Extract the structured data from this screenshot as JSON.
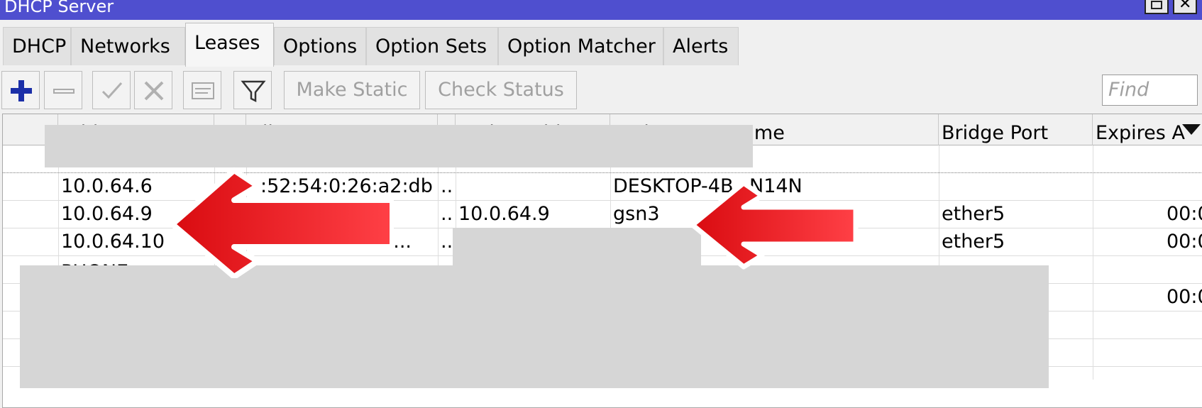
{
  "window": {
    "title": "DHCP Server",
    "maximize_icon": "maximize-icon",
    "close_icon": "close-icon",
    "close_glyph": "✕"
  },
  "tabs": [
    {
      "label": "DHCP"
    },
    {
      "label": "Networks"
    },
    {
      "label": "Leases"
    },
    {
      "label": "Options"
    },
    {
      "label": "Option Sets"
    },
    {
      "label": "Option Matcher"
    },
    {
      "label": "Alerts"
    }
  ],
  "active_tab": "Leases",
  "toolbar": {
    "icons": [
      "add-icon",
      "remove-icon",
      "enable-icon",
      "disable-icon",
      "comment-icon",
      "filter-icon"
    ],
    "make_static_label": "Make Static",
    "check_status_label": "Check Status",
    "find_placeholder": "Find",
    "accent_color": "#1b2fa8"
  },
  "table": {
    "columns": [
      "Address",
      "",
      "Client ID",
      "",
      "Active Address",
      "Active Host Name",
      "Bridge Port",
      "Expires A"
    ],
    "rows": [
      {
        "address": "",
        "client_id": "",
        "dots": "",
        "active_address": "",
        "host_name": "",
        "bridge_port": "",
        "expires": ""
      },
      {
        "address": "10.0.64.6",
        "client_id": ":52:54:0:26:a2:db",
        "dots": "..",
        "active_address": "",
        "host_name": "DESKTOP-4B",
        "host_name_tail": "N14N",
        "bridge_port": "",
        "expires": ""
      },
      {
        "address": "10.0.64.9",
        "client_id": "",
        "dots": "..",
        "active_address": "10.0.64.9",
        "host_name": "gsn3",
        "bridge_port": "ether5",
        "expires": "00:0"
      },
      {
        "address": "10.0.64.10",
        "client_id": "d:...",
        "dots": "..",
        "active_address": "",
        "host_name": "",
        "bridge_port": "ether5",
        "expires": "00:0"
      },
      {
        "address": "PHONE",
        "client_id": "",
        "dots": "",
        "active_address": "",
        "host_name": "",
        "bridge_port": "",
        "expires": ""
      },
      {
        "address": "",
        "client_id": "",
        "dots": "",
        "active_address": "",
        "host_name": "",
        "bridge_port": "",
        "expires": "00:0"
      }
    ]
  },
  "annotations": {
    "arrow_color": "#e0141b",
    "arrow_icon": "red-arrow-icon"
  }
}
